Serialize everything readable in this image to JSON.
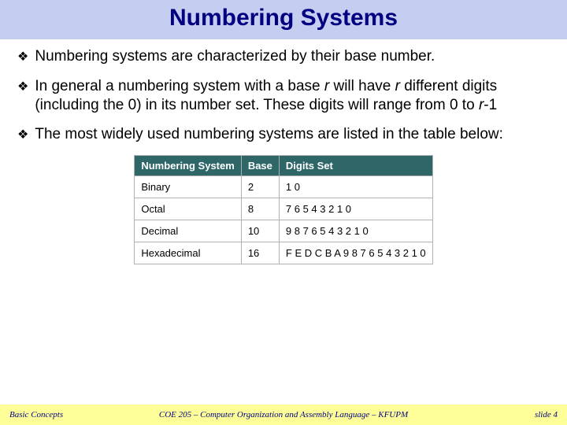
{
  "title": "Numbering Systems",
  "bullets": [
    {
      "text_html": "Numbering systems are characterized by their base number."
    },
    {
      "text_html": "In general a numbering system with a base <span class='italic'>r</span> will have <span class='italic'>r</span> different digits (including the 0) in its number set. These digits will range from 0 to <span class='italic'>r</span>-1"
    },
    {
      "text_html": "The most widely used numbering systems are listed in the table below:"
    }
  ],
  "table": {
    "headers": [
      "Numbering System",
      "Base",
      "Digits Set"
    ],
    "rows": [
      {
        "system": "Binary",
        "base": "2",
        "digits": "1 0"
      },
      {
        "system": "Octal",
        "base": "8",
        "digits": "7 6 5 4 3 2 1 0"
      },
      {
        "system": "Decimal",
        "base": "10",
        "digits": "9 8 7 6 5 4 3 2 1 0"
      },
      {
        "system": "Hexadecimal",
        "base": "16",
        "digits": "F E D C B A 9 8 7 6 5 4 3 2 1 0"
      }
    ]
  },
  "footer": {
    "left": "Basic Concepts",
    "center": "COE 205 – Computer Organization and Assembly Language – KFUPM",
    "right": "slide 4"
  },
  "bullet_marker": "❖"
}
